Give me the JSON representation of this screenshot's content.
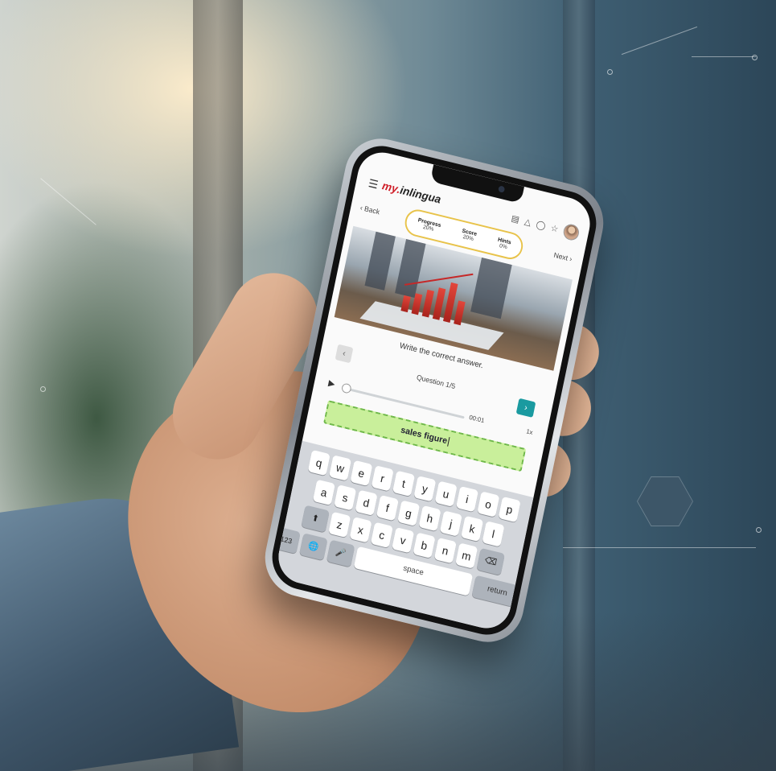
{
  "app": {
    "logo_prefix": "my.",
    "logo_name": "inlingua",
    "menu_icon": "menu-icon",
    "top_icons": [
      "notebook-icon",
      "bell-icon",
      "chat-icon",
      "trophy-icon"
    ]
  },
  "nav": {
    "back_label": "Back",
    "next_label": "Next"
  },
  "stats": {
    "progress_label": "Progress",
    "progress_value": "20%",
    "score_label": "Score",
    "score_value": "20%",
    "hints_label": "Hints",
    "hints_value": "0%"
  },
  "exercise": {
    "instruction": "Write the correct answer.",
    "question_label": "Question 1/5",
    "audio_time": "00:01",
    "audio_speed": "1x",
    "answer_value": "sales figure"
  },
  "keyboard": {
    "row1": [
      "q",
      "w",
      "e",
      "r",
      "t",
      "y",
      "u",
      "i",
      "o",
      "p"
    ],
    "row2": [
      "a",
      "s",
      "d",
      "f",
      "g",
      "h",
      "j",
      "k",
      "l"
    ],
    "row3": [
      "z",
      "x",
      "c",
      "v",
      "b",
      "n",
      "m"
    ],
    "numbers_key": "123",
    "space_label": "space",
    "return_label": "return"
  },
  "colors": {
    "brand_red": "#d0202a",
    "highlight_yellow": "#e8c34a",
    "teal": "#1a9aa0",
    "answer_green": "#c9ef9b"
  }
}
